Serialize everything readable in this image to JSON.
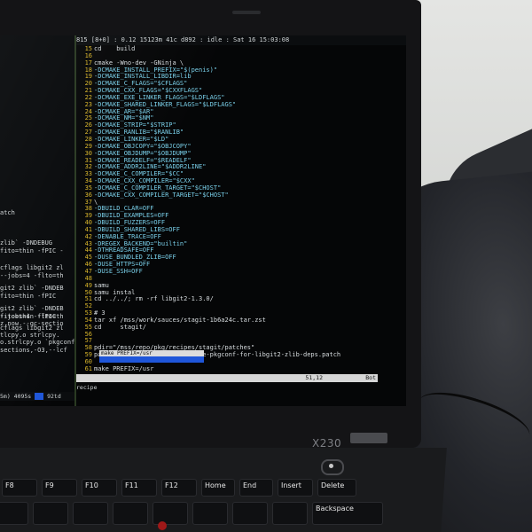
{
  "photo": {
    "laptop_model": "X230",
    "screen": {
      "left_pane_lines": [
        "atch",
        "zlib` -DNDEBUG",
        "fito=thin -fPIC -",
        "cflags libgit2 zl",
        "--jobs=4 -flto=th",
        "git2 zlib` -DNDEB",
        "fito=thin -fPIC",
        "git2 zlib` -DNDEB",
        "fito=thin -fPIC",
        "cflags libgit2 zl",
        "--jobs=4 -flto=th",
        "z.now.--gc-sectio",
        "tlcpy.o strlcpy.",
        "o.strlcpy.o `pkgconf -",
        "sections,-O3,--lcf"
      ],
      "tmux_left_status": "5m) 4095s",
      "tmux_left_status_right": "92td",
      "top_status": "815 [8+0] : 0.12 15123m 41c d892 : idle : Sat 16 15:03:08",
      "code_lines": [
        {
          "n": "15",
          "t": "cd    build"
        },
        {
          "n": "16",
          "t": ""
        },
        {
          "n": "17",
          "t": "cmake -Wno-dev -GNinja \\"
        },
        {
          "n": "18",
          "t": "-DCMAKE_INSTALL_PREFIX=\"$(penis)\""
        },
        {
          "n": "19",
          "t": "-DCMAKE_INSTALL_LIBDIR=lib"
        },
        {
          "n": "20",
          "t": "-DCMAKE_C_FLAGS=\"$CFLAGS\""
        },
        {
          "n": "21",
          "t": "-DCMAKE_CXX_FLAGS=\"$CXXFLAGS\""
        },
        {
          "n": "22",
          "t": "-DCMAKE_EXE_LINKER_FLAGS=\"$LDFLAGS\""
        },
        {
          "n": "23",
          "t": "-DCMAKE_SHARED_LINKER_FLAGS=\"$LDFLAGS\""
        },
        {
          "n": "24",
          "t": "-DCMAKE_AR=\"$AR\""
        },
        {
          "n": "25",
          "t": "-DCMAKE_NM=\"$NM\""
        },
        {
          "n": "26",
          "t": "-DCMAKE_STRIP=\"$STRIP\""
        },
        {
          "n": "27",
          "t": "-DCMAKE_RANLIB=\"$RANLIB\""
        },
        {
          "n": "28",
          "t": "-DCMAKE_LINKER=\"$LD\""
        },
        {
          "n": "29",
          "t": "-DCMAKE_OBJCOPY=\"$OBJCOPY\""
        },
        {
          "n": "30",
          "t": "-DCMAKE_OBJDUMP=\"$OBJDUMP\""
        },
        {
          "n": "31",
          "t": "-DCMAKE_READELF=\"$READELF\""
        },
        {
          "n": "32",
          "t": "-DCMAKE_ADDR2LINE=\"$ADDR2LINE\""
        },
        {
          "n": "33",
          "t": "-DCMAKE_C_COMPILER=\"$CC\""
        },
        {
          "n": "34",
          "t": "-DCMAKE_CXX_COMPILER=\"$CXX\""
        },
        {
          "n": "35",
          "t": "-DCMAKE_C_COMPILER_TARGET=\"$CHOST\""
        },
        {
          "n": "36",
          "t": "-DCMAKE_CXX_COMPILER_TARGET=\"$CHOST\""
        },
        {
          "n": "37",
          "t": "\\"
        },
        {
          "n": "38",
          "t": "-DBUILD_CLAR=OFF"
        },
        {
          "n": "39",
          "t": "-DBUILD_EXAMPLES=OFF"
        },
        {
          "n": "40",
          "t": "-DBUILD_FUZZERS=OFF"
        },
        {
          "n": "41",
          "t": "-DBUILD_SHARED_LIBS=OFF"
        },
        {
          "n": "42",
          "t": "-DENABLE_TRACE=OFF"
        },
        {
          "n": "43",
          "t": "-DREGEX_BACKEND=\"builtin\""
        },
        {
          "n": "44",
          "t": "-DTHREADSAFE=OFF"
        },
        {
          "n": "45",
          "t": "-DUSE_BUNDLED_ZLIB=OFF"
        },
        {
          "n": "46",
          "t": "-DUSE_HTTPS=OFF"
        },
        {
          "n": "47",
          "t": "-DUSE_SSH=OFF"
        },
        {
          "n": "48",
          "t": ""
        },
        {
          "n": "49",
          "t": "samu"
        },
        {
          "n": "50",
          "t": "samu instal"
        },
        {
          "n": "51",
          "t": "cd ../../; rm -rf libgit2-1.3.0/"
        },
        {
          "n": "52",
          "t": ""
        },
        {
          "n": "53",
          "t": "# 3"
        },
        {
          "n": "54",
          "t": "tar xf /mss/work/sauces/stagit-1b6a24c.tar.zst"
        },
        {
          "n": "55",
          "t": "cd     stagit/"
        },
        {
          "n": "56",
          "t": ""
        },
        {
          "n": "57",
          "t": ""
        },
        {
          "n": "58",
          "t": "pdir=\"/mss/repo/pkg/recipes/stagit/patches\""
        },
        {
          "n": "59",
          "t": "patch -p1 < \"$(pdir)\"/0001-use-pkgconf-for-libgit2-zlib-deps.patch"
        },
        {
          "n": "60",
          "t": ""
        },
        {
          "n": "61",
          "t": "make PREFIX=/usr"
        }
      ],
      "completion_selected": "make PREFIX=/usr",
      "status_position": "51,12",
      "status_scroll": "Bot",
      "cmdline": "recipe"
    },
    "keyboard": {
      "row1": [
        "F8",
        "F9",
        "F10",
        "F11",
        "F12",
        "Home",
        "End",
        "Insert",
        "Delete"
      ],
      "row2": [
        "",
        "",
        "",
        "",
        "",
        "",
        "",
        "",
        "Backspace"
      ]
    }
  }
}
